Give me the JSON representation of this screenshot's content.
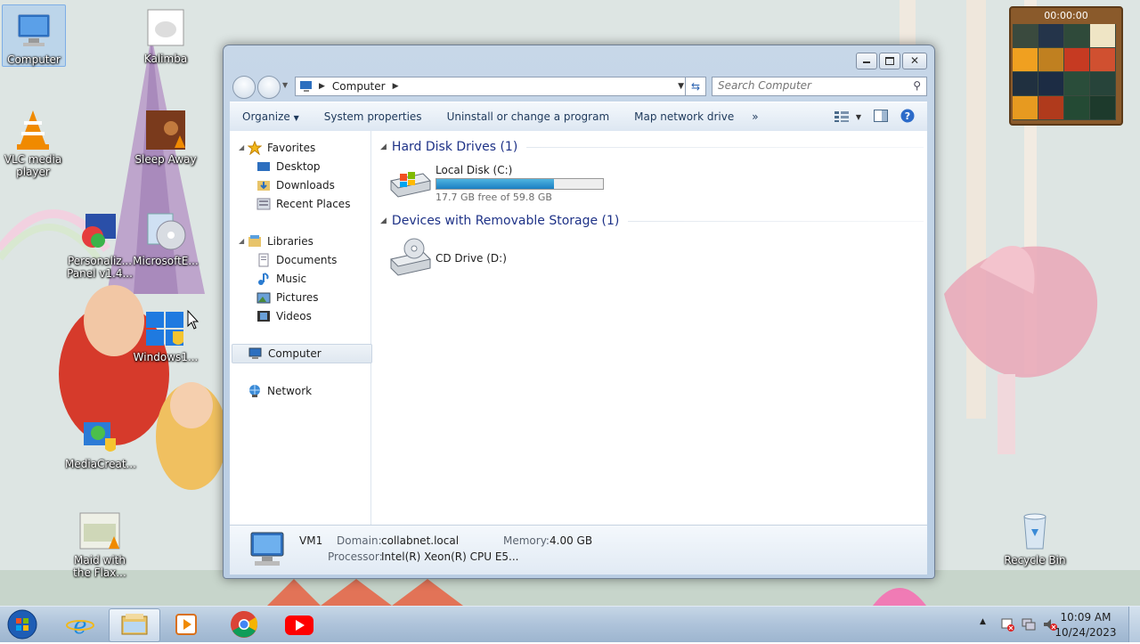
{
  "desktop": {
    "icons": [
      {
        "label": "Computer",
        "icon": "computer-icon"
      },
      {
        "label": "Kalimba",
        "icon": "music-album-icon"
      },
      {
        "label": "VLC media player",
        "icon": "vlc-cone-icon"
      },
      {
        "label": "Sleep Away",
        "icon": "music-album-icon"
      },
      {
        "label": "Personaliz... Panel v1.4...",
        "icon": "personalization-panel-icon"
      },
      {
        "label": "MicrosoftE...",
        "icon": "media-disc-icon"
      },
      {
        "label": "Windows1...",
        "icon": "windows-setup-icon"
      },
      {
        "label": "MediaCreat...",
        "icon": "media-creation-tool-icon"
      },
      {
        "label": "Maid with the Flax...",
        "icon": "music-album-icon"
      },
      {
        "label": "Recycle Bin",
        "icon": "recycle-bin-icon"
      }
    ],
    "gadget": {
      "timer": "00:00:00",
      "icon": "slide-puzzle-gadget-icon"
    }
  },
  "window": {
    "address": {
      "segments": [
        "Computer"
      ],
      "icon": "computer-icon"
    },
    "search": {
      "placeholder": "Search Computer"
    },
    "toolbar": {
      "organize": "Organize",
      "system_properties": "System properties",
      "uninstall": "Uninstall or change a program",
      "map_drive": "Map network drive",
      "more": "»"
    },
    "nav": {
      "favorites": "Favorites",
      "desktop": "Desktop",
      "downloads": "Downloads",
      "recent": "Recent Places",
      "libraries": "Libraries",
      "documents": "Documents",
      "music": "Music",
      "pictures": "Pictures",
      "videos": "Videos",
      "computer": "Computer",
      "network": "Network"
    },
    "groups": {
      "hdd": {
        "title": "Hard Disk Drives (1)"
      },
      "removable": {
        "title": "Devices with Removable Storage (1)"
      }
    },
    "drives": {
      "c": {
        "name": "Local Disk (C:)",
        "free": "17.7 GB free of 59.8 GB",
        "used_fraction": 0.704
      },
      "d": {
        "name": "CD Drive (D:)"
      }
    },
    "details": {
      "name": "VM1",
      "domain_label": "Domain:",
      "domain": "collabnet.local",
      "memory_label": "Memory:",
      "memory": "4.00 GB",
      "processor_label": "Processor:",
      "processor": "Intel(R) Xeon(R) CPU E5..."
    }
  },
  "taskbar": {
    "apps": [
      "start-orb-icon",
      "internet-explorer-icon",
      "windows-explorer-icon",
      "media-player-icon",
      "chrome-icon",
      "youtube-icon"
    ],
    "time": "10:09 AM",
    "date": "10/24/2023"
  }
}
